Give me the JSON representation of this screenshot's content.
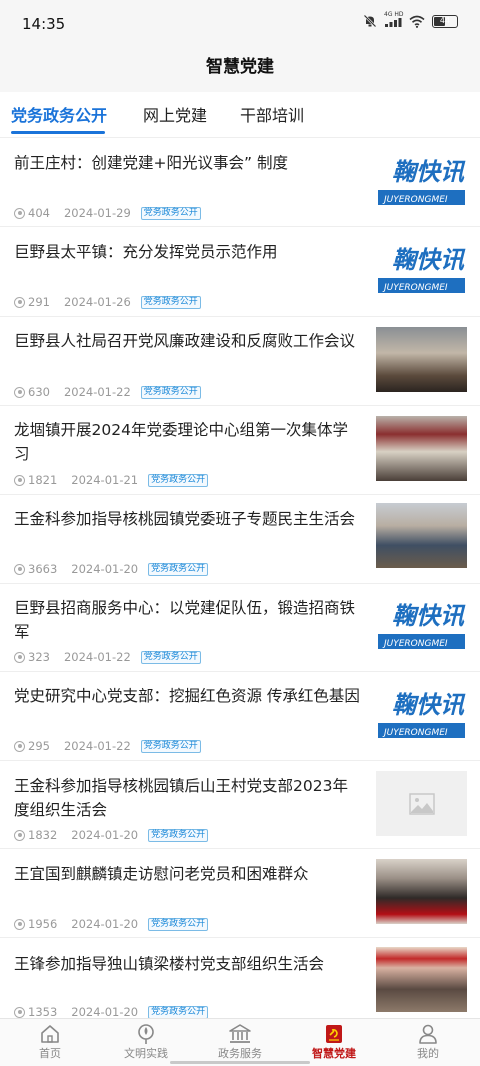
{
  "status_bar": {
    "time": "14:35",
    "network": "4G HD",
    "battery": "44"
  },
  "header": {
    "title": "智慧党建"
  },
  "tabs": [
    {
      "label": "党务政务公开",
      "active": true
    },
    {
      "label": "网上党建",
      "active": false
    },
    {
      "label": "干部培训",
      "active": false
    }
  ],
  "news": [
    {
      "title": "前王庄村：创建党建+阳光议事会” 制度",
      "views": "404",
      "date": "2024-01-29",
      "tag": "党务政务公开",
      "thumb": "logo",
      "logo_cn": "鞠快讯",
      "logo_en": "JUYERONGMEI"
    },
    {
      "title": "巨野县太平镇：充分发挥党员示范作用",
      "views": "291",
      "date": "2024-01-26",
      "tag": "党务政务公开",
      "thumb": "logo",
      "logo_cn": "鞠快讯",
      "logo_en": "JUYERONGMEI"
    },
    {
      "title": "巨野县人社局召开党风廉政建设和反腐败工作会议",
      "views": "630",
      "date": "2024-01-22",
      "tag": "党务政务公开",
      "thumb": "photo"
    },
    {
      "title": "龙堌镇开展2024年党委理论中心组第一次集体学习",
      "views": "1821",
      "date": "2024-01-21",
      "tag": "党务政务公开",
      "thumb": "photo"
    },
    {
      "title": "王金科参加指导核桃园镇党委班子专题民主生活会",
      "views": "3663",
      "date": "2024-01-20",
      "tag": "党务政务公开",
      "thumb": "photo"
    },
    {
      "title": "巨野县招商服务中心：以党建促队伍，锻造招商铁军",
      "views": "323",
      "date": "2024-01-22",
      "tag": "党务政务公开",
      "thumb": "logo",
      "logo_cn": "鞠快讯",
      "logo_en": "JUYERONGMEI"
    },
    {
      "title": "党史研究中心党支部：挖掘红色资源  传承红色基因",
      "views": "295",
      "date": "2024-01-22",
      "tag": "党务政务公开",
      "thumb": "logo",
      "logo_cn": "鞠快讯",
      "logo_en": "JUYERONGMEI"
    },
    {
      "title": "王金科参加指导核桃园镇后山王村党支部2023年度组织生活会",
      "views": "1832",
      "date": "2024-01-20",
      "tag": "党务政务公开",
      "thumb": "placeholder"
    },
    {
      "title": "王宜国到麒麟镇走访慰问老党员和困难群众",
      "views": "1956",
      "date": "2024-01-20",
      "tag": "党务政务公开",
      "thumb": "photo"
    },
    {
      "title": "王锋参加指导独山镇梁楼村党支部组织生活会",
      "views": "1353",
      "date": "2024-01-20",
      "tag": "党务政务公开",
      "thumb": "photo"
    }
  ],
  "bottom_nav": [
    {
      "label": "首页",
      "icon": "home-icon",
      "active": false
    },
    {
      "label": "文明实践",
      "icon": "civilization-icon",
      "active": false
    },
    {
      "label": "政务服务",
      "icon": "government-icon",
      "active": false
    },
    {
      "label": "智慧党建",
      "icon": "party-building-icon",
      "active": true
    },
    {
      "label": "我的",
      "icon": "profile-icon",
      "active": false
    }
  ],
  "colors": {
    "accent": "#1a73d9",
    "party_red": "#c01818",
    "tag_blue": "#1a88d8"
  }
}
